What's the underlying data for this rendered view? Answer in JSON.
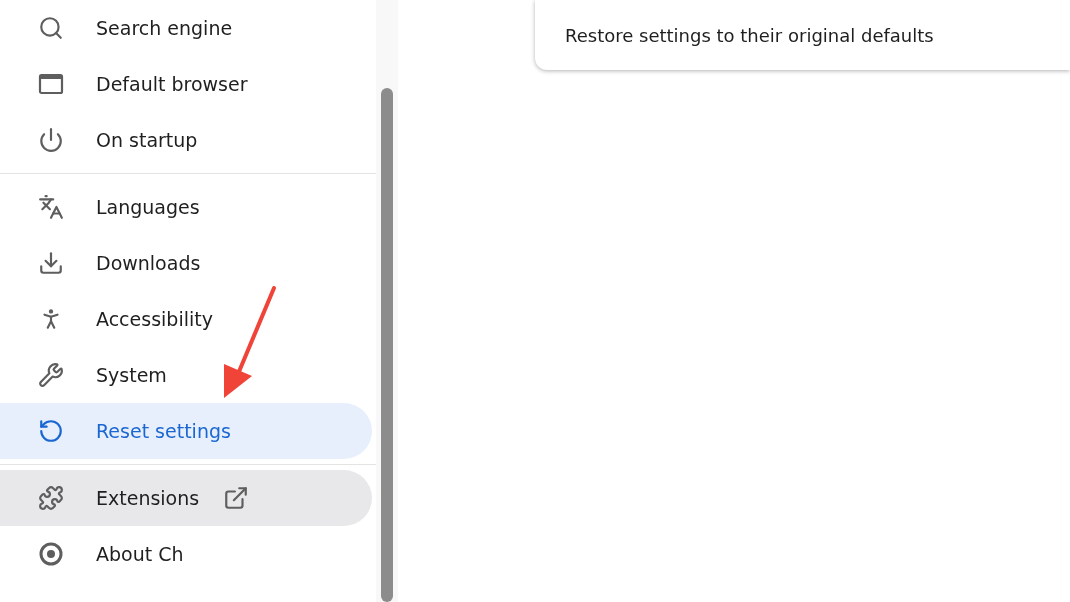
{
  "sidebar": {
    "sections": [
      {
        "items": [
          {
            "label": "Search engine",
            "selected": false,
            "hovered": false
          },
          {
            "label": "Default browser",
            "selected": false,
            "hovered": false
          },
          {
            "label": "On startup",
            "selected": false,
            "hovered": false
          }
        ]
      },
      {
        "items": [
          {
            "label": "Languages",
            "selected": false,
            "hovered": false
          },
          {
            "label": "Downloads",
            "selected": false,
            "hovered": false
          },
          {
            "label": "Accessibility",
            "selected": false,
            "hovered": false
          },
          {
            "label": "System",
            "selected": false,
            "hovered": false
          },
          {
            "label": "Reset settings",
            "selected": true,
            "hovered": false
          }
        ]
      },
      {
        "items": [
          {
            "label": "Extensions",
            "selected": false,
            "hovered": true,
            "external": true
          },
          {
            "label": "About Ch",
            "selected": false,
            "hovered": false
          }
        ]
      }
    ]
  },
  "main": {
    "card": {
      "text": "Restore settings to their original defaults"
    }
  }
}
